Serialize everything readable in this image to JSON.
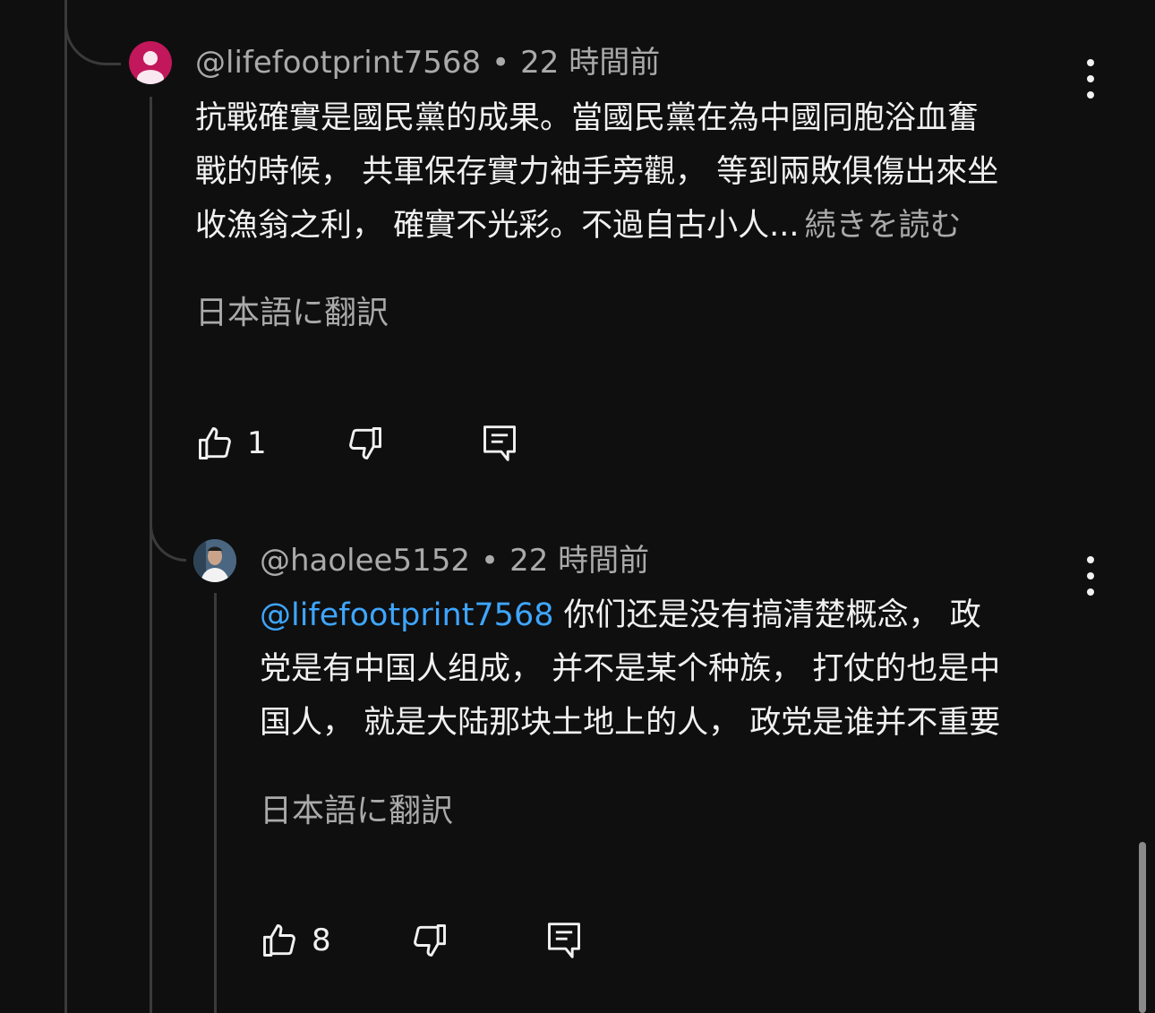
{
  "comments": [
    {
      "author": "@lifefootprint7568",
      "time": "22 時間前",
      "lines": [
        "抗戰確實是國民黨的成果。當國民黨在為中國同胞浴血奮",
        "戰的時候， 共軍保存實力袖手旁觀， 等到兩敗俱傷出來坐",
        "收漁翁之利， 確實不光彩。不過自古小人..."
      ],
      "more_label": "続きを読む",
      "translate_label": "日本語に翻訳",
      "like_count": "1",
      "icons": {
        "like": "thumbs-up-icon",
        "dislike": "thumbs-down-icon",
        "reply": "reply-comment-icon",
        "menu": "more-vert-icon"
      },
      "avatar_color": "#c2185b"
    },
    {
      "author": "@haolee5152",
      "time": "22 時間前",
      "mention": "@lifefootprint7568",
      "lines": [
        " 你们还是没有搞清楚概念， 政",
        "党是有中国人组成， 并不是某个种族， 打仗的也是中",
        "国人， 就是大陆那块土地上的人， 政党是谁并不重要"
      ],
      "translate_label": "日本語に翻訳",
      "like_count": "8",
      "icons": {
        "like": "thumbs-up-icon",
        "dislike": "thumbs-down-icon",
        "reply": "reply-comment-icon",
        "menu": "more-vert-icon"
      },
      "mention_color": "#3ea6ff"
    }
  ],
  "separator": "•"
}
